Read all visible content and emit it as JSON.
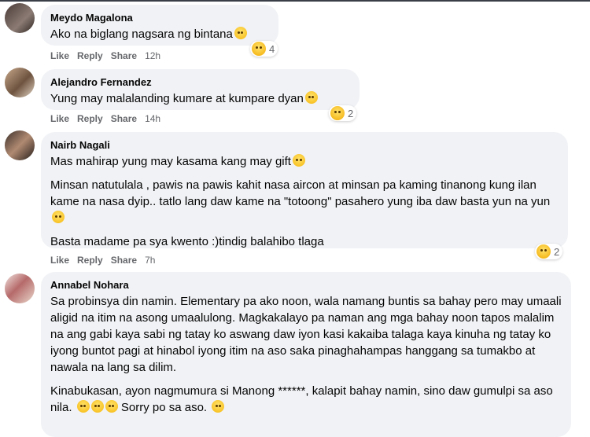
{
  "actions": {
    "like": "Like",
    "reply": "Reply",
    "share": "Share"
  },
  "comments": [
    {
      "name": "Meydo Magalona",
      "lines": [
        "Ako na biglang nagsara ng bintana"
      ],
      "time": "12h",
      "reaction_count": "4"
    },
    {
      "name": "Alejandro Fernandez",
      "lines": [
        "Yung may malalanding kumare at kumpare dyan"
      ],
      "time": "14h",
      "reaction_count": "2"
    },
    {
      "name": "Nairb Nagali",
      "paragraphs": [
        "Mas mahirap yung may kasama kang may gift",
        "Minsan natutulala , pawis na pawis kahit nasa aircon at minsan pa kaming tinanong kung ilan kame na nasa dyip.. tatlo lang daw kame na \"totoong\" pasahero yung iba daw basta yun na yun",
        "Basta madame pa sya kwento :)tindig balahibo tlaga"
      ],
      "time": "7h",
      "reaction_count": "2"
    },
    {
      "name": "Annabel Nohara",
      "paragraphs": [
        "Sa probinsya din namin. Elementary pa ako noon, wala namang buntis sa bahay pero may umaali aligid na itim na asong umaalulong. Magkakalayo pa naman ang mga bahay noon tapos malalim na ang gabi kaya sabi ng tatay ko aswang daw iyon kasi kakaiba talaga kaya kinuha ng tatay ko iyong buntot pagi at hinabol iyong itim na aso saka pinaghahampas hanggang sa tumakbo at nawala na lang sa dilim.",
        "Kinabukasan, ayon nagmumura si Manong ******, kalapit bahay namin, sino daw gumulpi sa aso nila.",
        "Sorry po sa aso."
      ]
    }
  ]
}
